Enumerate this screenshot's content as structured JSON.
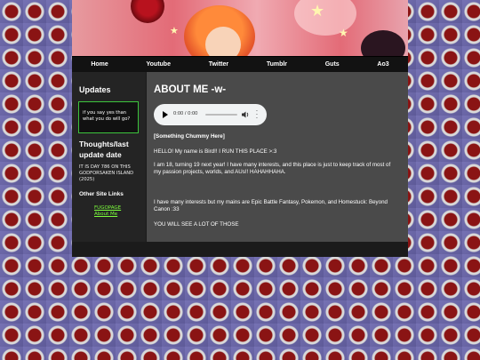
{
  "nav": {
    "items": [
      {
        "label": "Home"
      },
      {
        "label": "Youtube"
      },
      {
        "label": "Twitter"
      },
      {
        "label": "Tumblr"
      },
      {
        "label": "Guts"
      },
      {
        "label": "Ao3"
      }
    ]
  },
  "sidebar": {
    "updates_heading": "Updates",
    "quote": "if you say yes than what you do will go?",
    "thoughts_heading": "Thoughts/last update date",
    "thoughts_text": "IT IS DAY 786 ON THIS GODFORSAKEN ISLAND (2025)",
    "other_links_heading": "Other Site Links",
    "links": [
      {
        "label": "FUGOPAGE"
      },
      {
        "label": "About Me"
      }
    ]
  },
  "main": {
    "title": "ABOUT ME -w-",
    "audio": {
      "time": "0:00 / 0:00"
    },
    "subheading": "[Something Chummy Here]",
    "paragraphs": [
      "HELLO! My name is Bird!! I RUN THIS PLACE >:3",
      "I am 18, turning 19 next year! I have many interests, and this place is just to keep track of most of my passion projects, worlds, and AUs!! HAHAHHAHA.",
      "I have many interests but my mains are Epic Battle Fantasy, Pokemon, and Homestuck: Beyond Canon :33",
      "YOU WILL SEE A LOT OF THOSE"
    ]
  },
  "colors": {
    "nav_bg": "#121212",
    "sidebar_bg": "#242424",
    "main_bg": "#4a4a4a",
    "link": "#7cff3c",
    "box_border": "#3cc43c"
  },
  "icons": [
    "play-icon",
    "volume-icon",
    "more-vertical-icon"
  ]
}
